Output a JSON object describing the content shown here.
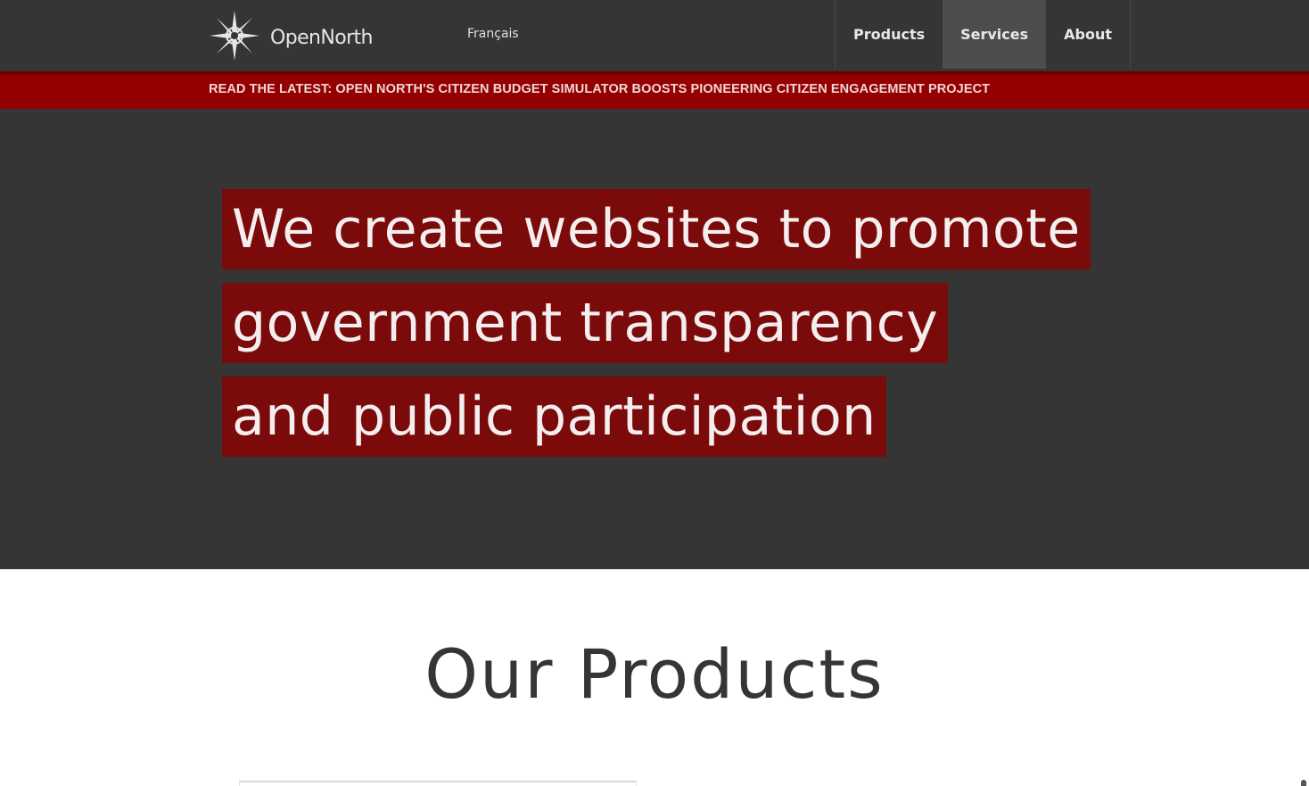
{
  "header": {
    "logo_text": "OpenNorth",
    "language_link": "Français",
    "nav": [
      {
        "label": "Products",
        "active": false
      },
      {
        "label": "Services",
        "active": true
      },
      {
        "label": "About",
        "active": false
      }
    ]
  },
  "announcement": {
    "text": "READ THE LATEST: OPEN NORTH'S CITIZEN BUDGET SIMULATOR BOOSTS PIONEERING CITIZEN ENGAGEMENT PROJECT"
  },
  "hero": {
    "lines": [
      "We create websites to promote",
      "government transparency",
      "and public participation"
    ]
  },
  "products": {
    "title": "Our Products"
  },
  "colors": {
    "header_bg": "#353535",
    "announcement_bg": "#940000",
    "highlight_bg": "#7b0a0a",
    "nav_active_bg": "#4d4d4d"
  },
  "icons": {
    "logo": "compass-star-icon"
  }
}
